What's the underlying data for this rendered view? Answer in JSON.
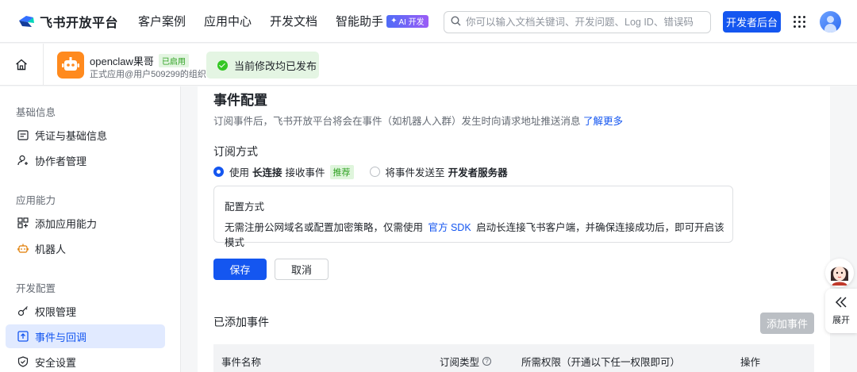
{
  "brand": {
    "name": "飞书开放平台"
  },
  "nav": {
    "items": [
      "客户案例",
      "应用中心",
      "开发文档",
      "智能助手"
    ],
    "ai_badge": "AI 开发"
  },
  "search": {
    "placeholder": "你可以输入文档关键词、开发问题、Log ID、错误码"
  },
  "dev_console_label": "开发者后台",
  "app": {
    "name": "openclaw果哥",
    "status": "已启用",
    "subtitle": "正式应用@用户509299的组织"
  },
  "toast": {
    "message": "当前修改均已发布"
  },
  "sidebar": {
    "groups": [
      "基础信息",
      "应用能力",
      "开发配置"
    ],
    "items": [
      "凭证与基础信息",
      "协作者管理",
      "添加应用能力",
      "机器人",
      "权限管理",
      "事件与回调",
      "安全设置"
    ]
  },
  "main": {
    "title": "事件配置",
    "description": "订阅事件后，飞书开放平台将会在事件（如机器人入群）发生时向请求地址推送消息",
    "learn_more": "了解更多",
    "subscribe_title": "订阅方式",
    "option1": {
      "prefix": "使用",
      "bold": "长连接",
      "suffix": "接收事件",
      "badge": "推荐"
    },
    "option2": {
      "prefix": "将事件发送至",
      "bold": "开发者服务器"
    },
    "config": {
      "title": "配置方式",
      "desc_before": "无需注册公网域名或配置加密策略，仅需使用",
      "desc_link": "官方 SDK",
      "desc_after": "启动长连接飞书客户端，并确保连接成功后，即可开启该模式"
    },
    "save_label": "保存",
    "cancel_label": "取消",
    "added_title": "已添加事件",
    "add_event_label": "添加事件",
    "table": {
      "headers": [
        "事件名称",
        "订阅类型",
        "所需权限（开通以下任一权限即可）",
        "操作"
      ]
    }
  },
  "expand_label": "展开",
  "colors": {
    "primary": "#1456f0",
    "success": "#34c724",
    "app_icon": "#ff8a1e"
  }
}
